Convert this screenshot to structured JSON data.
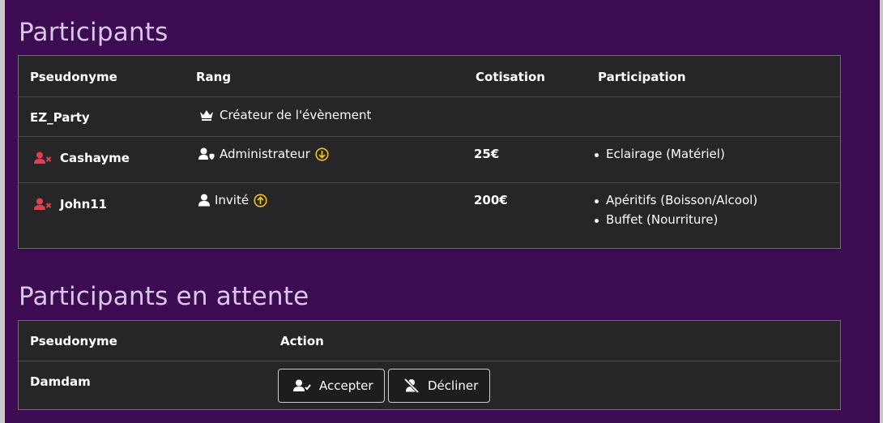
{
  "participants": {
    "title": "Participants",
    "headers": {
      "pseudonyme": "Pseudonyme",
      "rang": "Rang",
      "cotisation": "Cotisation",
      "participation": "Participation"
    },
    "rows": [
      {
        "pseudonyme": "EZ_Party",
        "rang": "Créateur de l'évènement",
        "rang_icon": "crown-icon",
        "cotisation": "",
        "participation": []
      },
      {
        "pseudonyme": "Cashayme",
        "remove_icon": "user-remove-icon",
        "rang": "Administrateur",
        "rang_icon": "user-shield-icon",
        "rank_action_icon": "demote-icon",
        "cotisation": "25€",
        "participation": [
          "Eclairage (Matériel)"
        ]
      },
      {
        "pseudonyme": "John11",
        "remove_icon": "user-remove-icon",
        "rang": "Invité",
        "rang_icon": "user-icon",
        "rank_action_icon": "promote-icon",
        "cotisation": "200€",
        "participation": [
          "Apéritifs (Boisson/Alcool)",
          "Buffet (Nourriture)"
        ]
      }
    ]
  },
  "pending": {
    "title": "Participants en attente",
    "headers": {
      "pseudonyme": "Pseudonyme",
      "action": "Action"
    },
    "rows": [
      {
        "pseudonyme": "Damdam",
        "accept_label": "Accepter",
        "decline_label": "Décliner"
      }
    ]
  },
  "colors": {
    "background": "#3d0b52",
    "table_bg": "#262528",
    "title": "#d9c6e8",
    "remove_red": "#e0424d",
    "rank_gold": "#f2c318"
  }
}
